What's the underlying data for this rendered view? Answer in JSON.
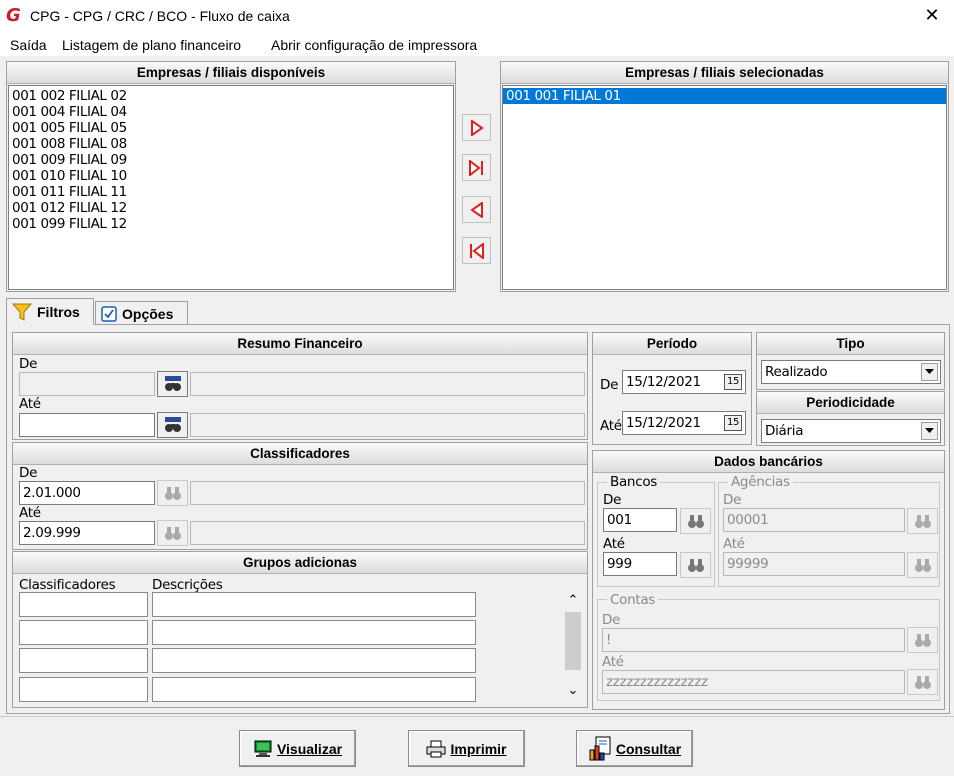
{
  "window": {
    "title": "CPG - CPG / CRC / BCO - Fluxo de caixa",
    "logo": "G",
    "close": "✕"
  },
  "menu": [
    "Saída",
    "Listagem de plano financeiro",
    "Abrir configuração de impressora"
  ],
  "available": {
    "header": "Empresas / filiais disponíveis",
    "items": [
      "001 002 FILIAL 02",
      "001 004 FILIAL 04",
      "001 005 FILIAL 05",
      "001 008 FILIAL 08",
      "001 009 FILIAL 09",
      "001 010 FILIAL 10",
      "001 011 FILIAL 11",
      "001 012 FILIAL 12",
      "001 099 FILIAL 12"
    ]
  },
  "selected": {
    "header": "Empresas / filiais selecionadas",
    "items": [
      "001 001 FILIAL 01"
    ]
  },
  "transfer_icons": [
    "arrow-right-icon",
    "arrow-right-all-icon",
    "arrow-left-icon",
    "arrow-left-all-icon"
  ],
  "tabs": [
    {
      "label": "Filtros",
      "icon": "funnel-icon",
      "active": true
    },
    {
      "label": "Opções",
      "icon": "checkbox-icon",
      "active": false
    }
  ],
  "resumo": {
    "header": "Resumo Financeiro",
    "de_label": "De",
    "ate_label": "Até",
    "de_value": "",
    "ate_value": ""
  },
  "classificadores": {
    "header": "Classificadores",
    "de_label": "De",
    "ate_label": "Até",
    "de_value": "2.01.000",
    "ate_value": "2.09.999"
  },
  "grupos": {
    "header": "Grupos adicionas",
    "col1": "Classificadores",
    "col2": "Descrições",
    "rows": 4,
    "scroll_up": "⌃",
    "scroll_down": "⌄"
  },
  "periodo": {
    "header": "Período",
    "de_label": "De",
    "ate_label": "Até",
    "de_value": "15/12/2021",
    "ate_value": "15/12/2021",
    "calendar": "15"
  },
  "tipo": {
    "header": "Tipo",
    "value": "Realizado"
  },
  "periodicidade": {
    "header": "Periodicidade",
    "value": "Diária"
  },
  "dados": {
    "header": "Dados bancários",
    "bancos": {
      "title": "Bancos",
      "de_label": "De",
      "ate_label": "Até",
      "de_value": "001",
      "ate_value": "999"
    },
    "agencias": {
      "title": "Agências",
      "de_label": "De",
      "ate_label": "Até",
      "de_value": "00001",
      "ate_value": "99999"
    },
    "contas": {
      "title": "Contas",
      "de_label": "De",
      "ate_label": "Até",
      "de_value": "!",
      "ate_value": "zzzzzzzzzzzzzzz"
    }
  },
  "buttons": {
    "visualizar": "Visualizar",
    "imprimir": "Imprimir",
    "consultar": "Consultar"
  },
  "colors": {
    "selection": "#0078d7",
    "arrow": "#e02020",
    "logo": "#c8202a"
  }
}
